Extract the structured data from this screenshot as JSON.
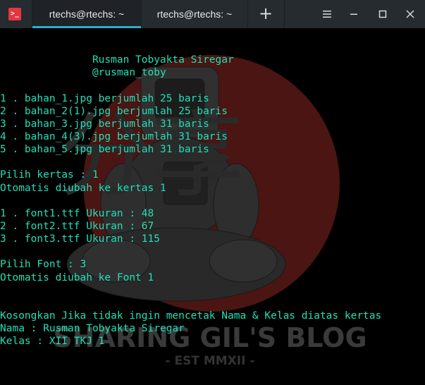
{
  "titlebar": {
    "app_icon_glyph": ">_",
    "tabs": [
      {
        "label": "rtechs@rtechs: ~",
        "active": true
      },
      {
        "label": "rtechs@rtechs: ~",
        "active": false
      }
    ],
    "new_tab_glyph": "+"
  },
  "colors": {
    "titlebar_bg": "#262b30",
    "active_tab_accent": "#28b0c8",
    "terminal_bg": "#000000",
    "terminal_text": "#1fe0b8",
    "app_icon": "#e6353f"
  },
  "watermark": {
    "title": "SHARING GIL'S BLOG",
    "subtitle": "- EST MMXII -",
    "chinese_chars": "分享"
  },
  "terminal": {
    "lines": [
      "",
      "               Rusman Tobyakta Siregar",
      "               @rusman_toby",
      "",
      "1 . bahan_1.jpg berjumlah 25 baris",
      "2 . bahan_2(1).jpg berjumlah 25 baris",
      "3 . bahan_3.jpg berjumlah 31 baris",
      "4 . bahan_4(3).jpg berjumlah 31 baris",
      "5 . bahan_5.jpg berjumlah 31 baris",
      "",
      "Pilih kertas : 1",
      "Otomatis diubah ke kertas 1",
      "",
      "1 . font1.ttf Ukuran : 48",
      "2 . font2.ttf Ukuran : 67",
      "3 . font3.ttf Ukuran : 115",
      "",
      "Pilih Font : 3",
      "Otomatis diubah ke Font 1",
      "",
      "",
      "Kosongkan Jika tidak ingin mencetak Nama & Kelas diatas kertas",
      "Nama : Rusman Tobyakta Siregar",
      "Kelas : XII TKJ 1"
    ]
  }
}
